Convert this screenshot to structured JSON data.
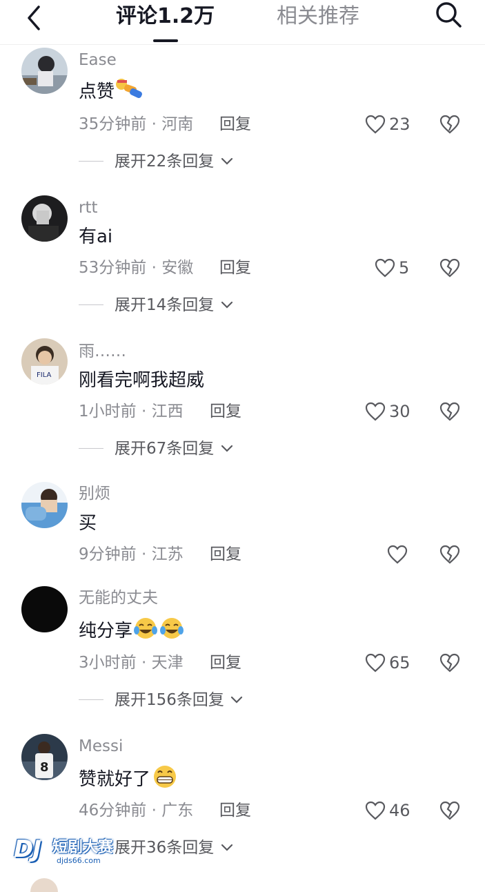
{
  "header": {
    "tab_comments": "评论1.2万",
    "tab_related": "相关推荐"
  },
  "comments": [
    {
      "username": "Ease",
      "content": "点赞",
      "time": "35分钟前",
      "location": "河南",
      "reply": "回复",
      "likes": "23",
      "expand": "展开22条回复"
    },
    {
      "username": "rtt",
      "content": "有ai",
      "time": "53分钟前",
      "location": "安徽",
      "reply": "回复",
      "likes": "5",
      "expand": "展开14条回复"
    },
    {
      "username": "雨……",
      "content": "刚看完啊我超威",
      "time": "1小时前",
      "location": "江西",
      "reply": "回复",
      "likes": "30",
      "expand": "展开67条回复"
    },
    {
      "username": "别烦",
      "content": "买",
      "time": "9分钟前",
      "location": "江苏",
      "reply": "回复",
      "likes": "",
      "expand": ""
    },
    {
      "username": "无能的丈夫",
      "content": "纯分享",
      "time": "3小时前",
      "location": "天津",
      "reply": "回复",
      "likes": "65",
      "expand": "展开156条回复"
    },
    {
      "username": "Messi",
      "content": "赞就好了",
      "time": "46分钟前",
      "location": "广东",
      "reply": "回复",
      "likes": "46",
      "expand": "展开36条回复"
    }
  ],
  "meta_separator": "·",
  "watermark": {
    "logo": "DJ",
    "title": "短剧大赛",
    "url": "djds66.com"
  },
  "colors": {
    "text": "#161823",
    "muted": "#8a8b91",
    "watermark_blue": "#1a5fb4"
  }
}
